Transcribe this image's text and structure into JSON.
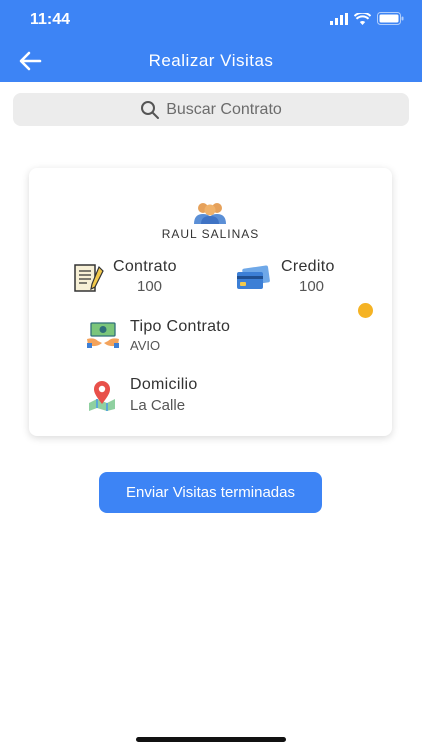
{
  "status": {
    "time": "11:44"
  },
  "header": {
    "title": "Realizar Visitas"
  },
  "search": {
    "placeholder": "Buscar Contrato"
  },
  "card": {
    "client_name": "RAUL SALINAS",
    "contrato": {
      "label": "Contrato",
      "value": "100"
    },
    "credito": {
      "label": "Credito",
      "value": "100"
    },
    "tipo_contrato": {
      "label": "Tipo Contrato",
      "value": "AVIO"
    },
    "domicilio": {
      "label": "Domicilio",
      "value": "La Calle"
    }
  },
  "actions": {
    "send_label": "Enviar Visitas terminadas"
  },
  "colors": {
    "primary": "#3d84f5",
    "indicator": "#f5b324",
    "search_bg": "#ececec"
  },
  "icons": [
    "back-arrow-icon",
    "search-icon",
    "client-avatar-icon",
    "contract-icon",
    "credit-card-icon",
    "money-icon",
    "location-pin-icon"
  ]
}
